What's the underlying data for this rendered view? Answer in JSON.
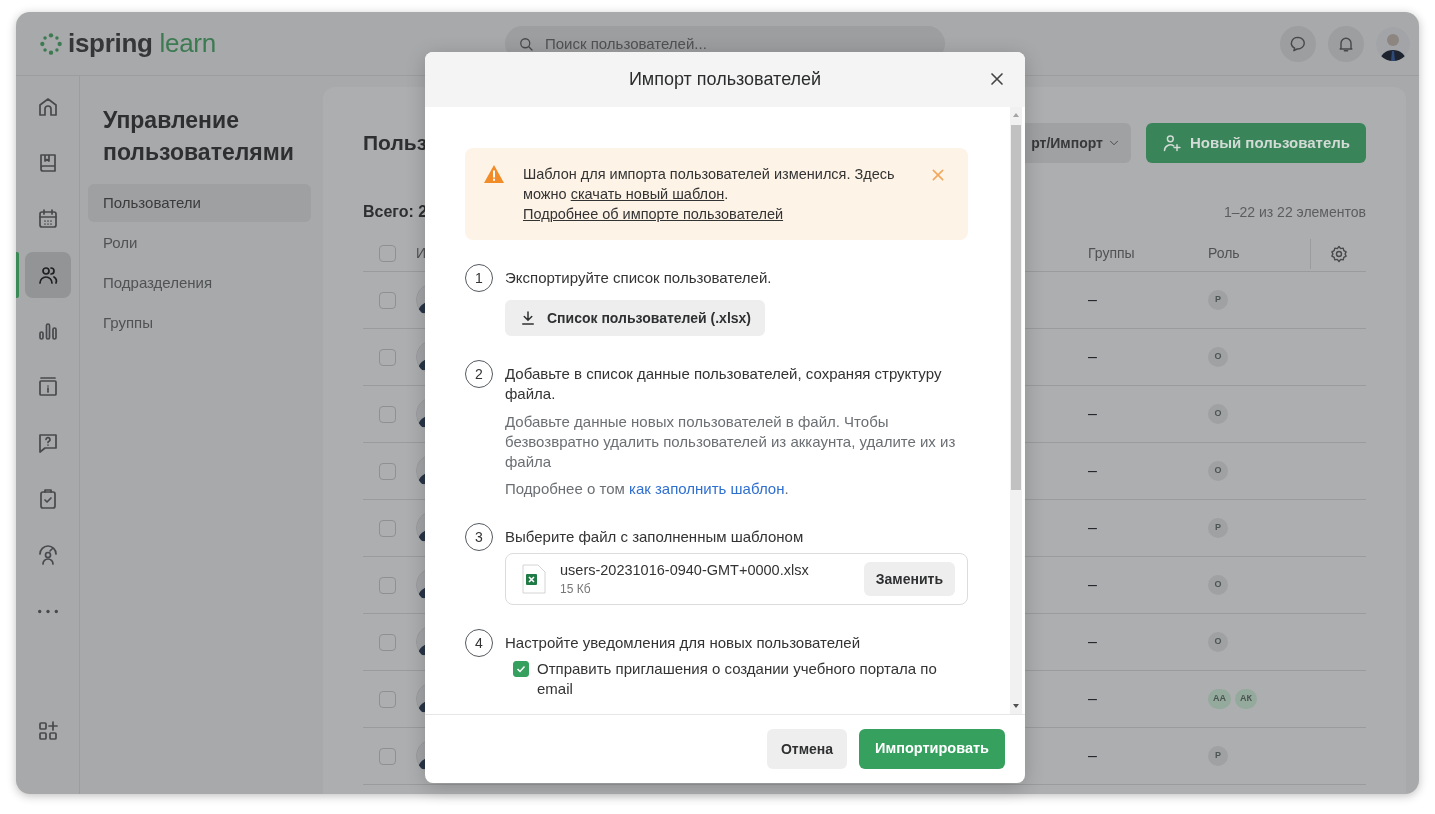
{
  "topbar": {
    "logo": {
      "brand": "ispring",
      "product": "learn"
    },
    "search": {
      "placeholder": "Поиск пользователей..."
    }
  },
  "rail": {
    "items": [
      {
        "kind": "home",
        "selected": false
      },
      {
        "kind": "book",
        "selected": false
      },
      {
        "kind": "calendar",
        "selected": false
      },
      {
        "kind": "users",
        "selected": true
      },
      {
        "kind": "chart",
        "selected": false
      },
      {
        "kind": "info",
        "selected": false
      },
      {
        "kind": "question",
        "selected": false
      },
      {
        "kind": "clipboard",
        "selected": false
      },
      {
        "kind": "coach",
        "selected": false
      },
      {
        "kind": "more",
        "selected": false
      }
    ],
    "bottom": {
      "kind": "apps",
      "selected": false
    }
  },
  "sidebar": {
    "title": "Управление пользователями",
    "items": [
      {
        "label": "Пользователи",
        "selected": true
      },
      {
        "label": "Роли",
        "selected": false
      },
      {
        "label": "Подразделения",
        "selected": false
      },
      {
        "label": "Группы",
        "selected": false
      }
    ]
  },
  "content": {
    "title": "Польз",
    "export_button": "рт/Импорт",
    "new_user_button": "Новый пользователь",
    "total": "Всего: 2",
    "range": "1–22 из 22 элементов",
    "table": {
      "header_checked": false,
      "columns": [
        "И",
        "Группы",
        "Роль"
      ],
      "rows": [
        {
          "checked": false,
          "groups": "–",
          "roles": [
            {
              "label": "Р",
              "color": "#9fa1a3"
            }
          ]
        },
        {
          "checked": false,
          "groups": "–",
          "roles": [
            {
              "label": "О",
              "color": "#9fa1a3"
            }
          ]
        },
        {
          "checked": false,
          "groups": "–",
          "roles": [
            {
              "label": "О",
              "color": "#9fa1a3"
            }
          ]
        },
        {
          "checked": false,
          "groups": "–",
          "roles": [
            {
              "label": "О",
              "color": "#9fa1a3"
            }
          ]
        },
        {
          "checked": false,
          "groups": "–",
          "roles": [
            {
              "label": "Р",
              "color": "#9fa1a3"
            }
          ]
        },
        {
          "checked": false,
          "groups": "–",
          "roles": [
            {
              "label": "О",
              "color": "#9fa1a3"
            }
          ]
        },
        {
          "checked": false,
          "groups": "–",
          "roles": [
            {
              "label": "О",
              "color": "#9fa1a3"
            }
          ]
        },
        {
          "checked": false,
          "groups": "–",
          "roles": [
            {
              "label": "АА",
              "color": "#94aa9d"
            },
            {
              "label": "АК",
              "color": "#94aa9d"
            }
          ]
        },
        {
          "checked": false,
          "groups": "–",
          "roles": [
            {
              "label": "Р",
              "color": "#9fa1a3"
            }
          ]
        }
      ]
    }
  },
  "dialog": {
    "title": "Импорт пользователей",
    "alert": {
      "text": "Шаблон для импорта пользователей изменился. Здесь можно ",
      "link": "скачать новый шаблон",
      "after": ".",
      "link2": "Подробнее об импорте пользователей"
    },
    "steps": [
      {
        "number": "1",
        "kind": "download",
        "text": "Экспортируйте список пользователей.",
        "button": "Список пользователей (.xlsx)"
      },
      {
        "number": "2",
        "kind": "info",
        "text": "Добавьте в список данные пользователей, сохраняя структуру файла.",
        "note": "Добавьте данные новых пользователей в файл. Чтобы безвозвратно удалить пользователей из аккаунта, удалите их из файла",
        "more": "Подробнее о том ",
        "more_link": "как заполнить шаблон",
        "more_after": "."
      },
      {
        "number": "3",
        "kind": "file",
        "text": "Выберите файл с заполненным шаблоном",
        "file_name": "users-20231016-0940-GMT+0000.xlsx",
        "file_size": "15 Кб",
        "button": "Заменить"
      },
      {
        "number": "4",
        "kind": "checkbox",
        "text": "Настройте уведомления для новых пользователей",
        "option": "Отправить приглашения о создании учебного портала по email",
        "checked": true
      }
    ],
    "buttons": {
      "cancel": "Отмена",
      "confirm": "Импортировать"
    }
  }
}
